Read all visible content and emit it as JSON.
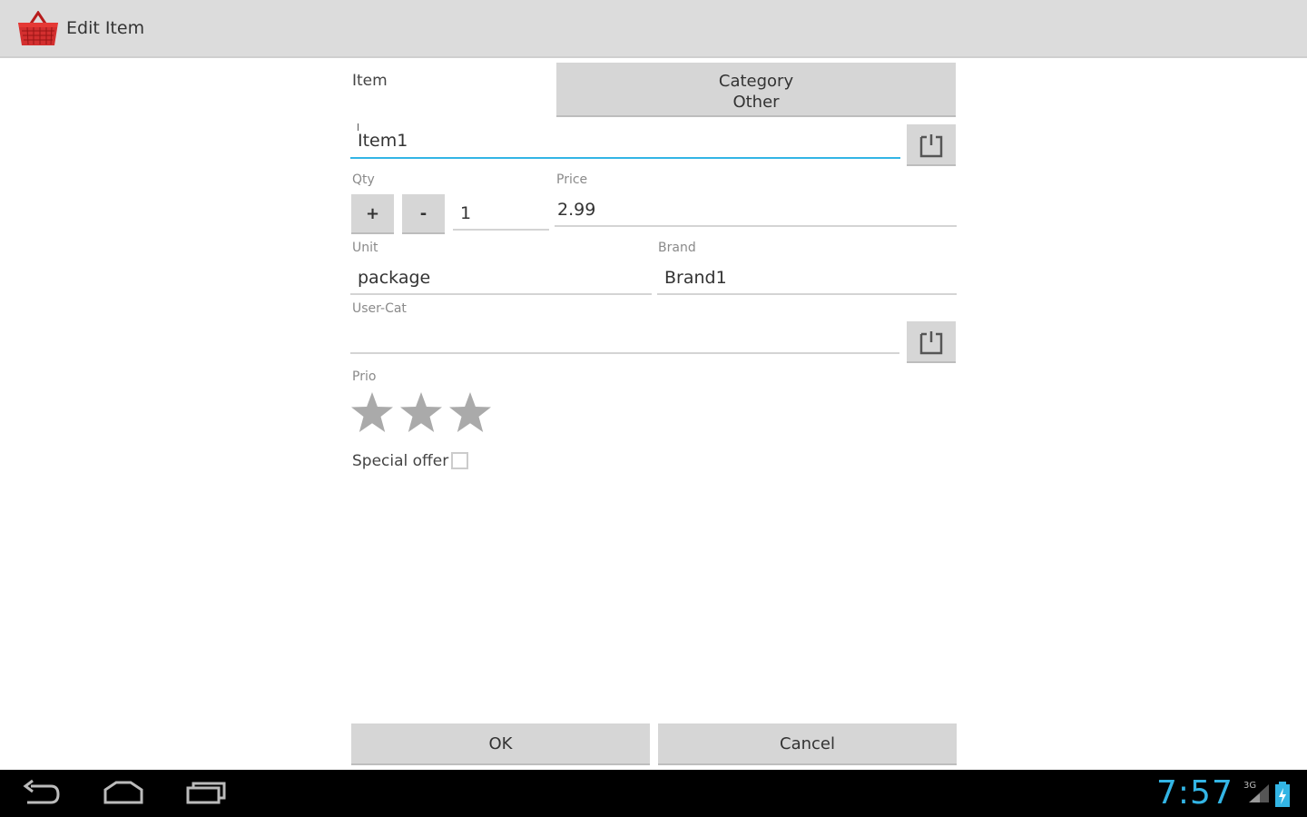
{
  "app": {
    "title": "Edit Item"
  },
  "form": {
    "item_label": "Item",
    "category": {
      "line1": "Category",
      "line2": "Other"
    },
    "item_value": "Item1",
    "qty_label": "Qty",
    "qty_plus": "+",
    "qty_minus": "-",
    "qty_value": "1",
    "price_label": "Price",
    "price_value": "2.99",
    "unit_label": "Unit",
    "unit_value": "package",
    "brand_label": "Brand",
    "brand_value": "Brand1",
    "usercat_label": "User-Cat",
    "usercat_value": "",
    "prio_label": "Prio",
    "prio_stars_filled": 0,
    "prio_stars_total": 3,
    "special_offer_label": "Special offer",
    "special_offer_checked": false
  },
  "actions": {
    "ok": "OK",
    "cancel": "Cancel"
  },
  "status": {
    "time": "7:57",
    "network": "3G",
    "accent_color": "#33b5e5"
  },
  "nav": {
    "icons": [
      "back-icon",
      "home-icon",
      "recent-apps-icon"
    ]
  }
}
